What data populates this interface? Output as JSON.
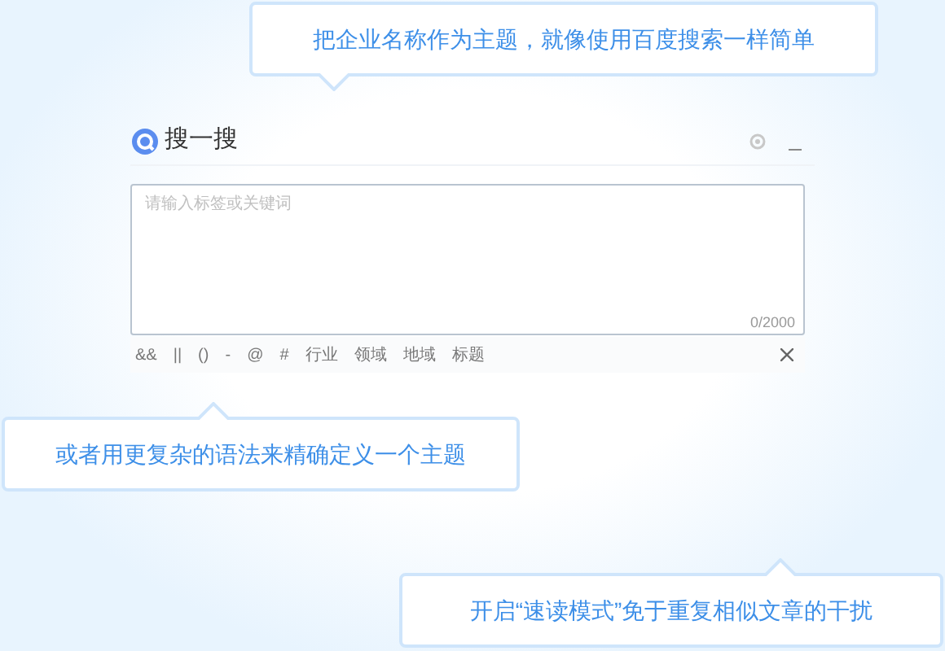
{
  "panel": {
    "title": "搜一搜",
    "search": {
      "placeholder": "请输入标签或关键词",
      "counter": "0/2000"
    },
    "syntax_items": [
      "&&",
      "||",
      "()",
      "-",
      "@",
      "#",
      "行业",
      "领域",
      "地域",
      "标题"
    ]
  },
  "callouts": [
    {
      "text": "把企业名称作为主题，就像使用百度搜索一样简单",
      "kind": "down"
    },
    {
      "text": "或者用更复杂的语法来精确定义一个主题",
      "kind": "up"
    },
    {
      "text": "开启“速读模式”免于重复相似文章的干扰",
      "kind": "up"
    }
  ]
}
